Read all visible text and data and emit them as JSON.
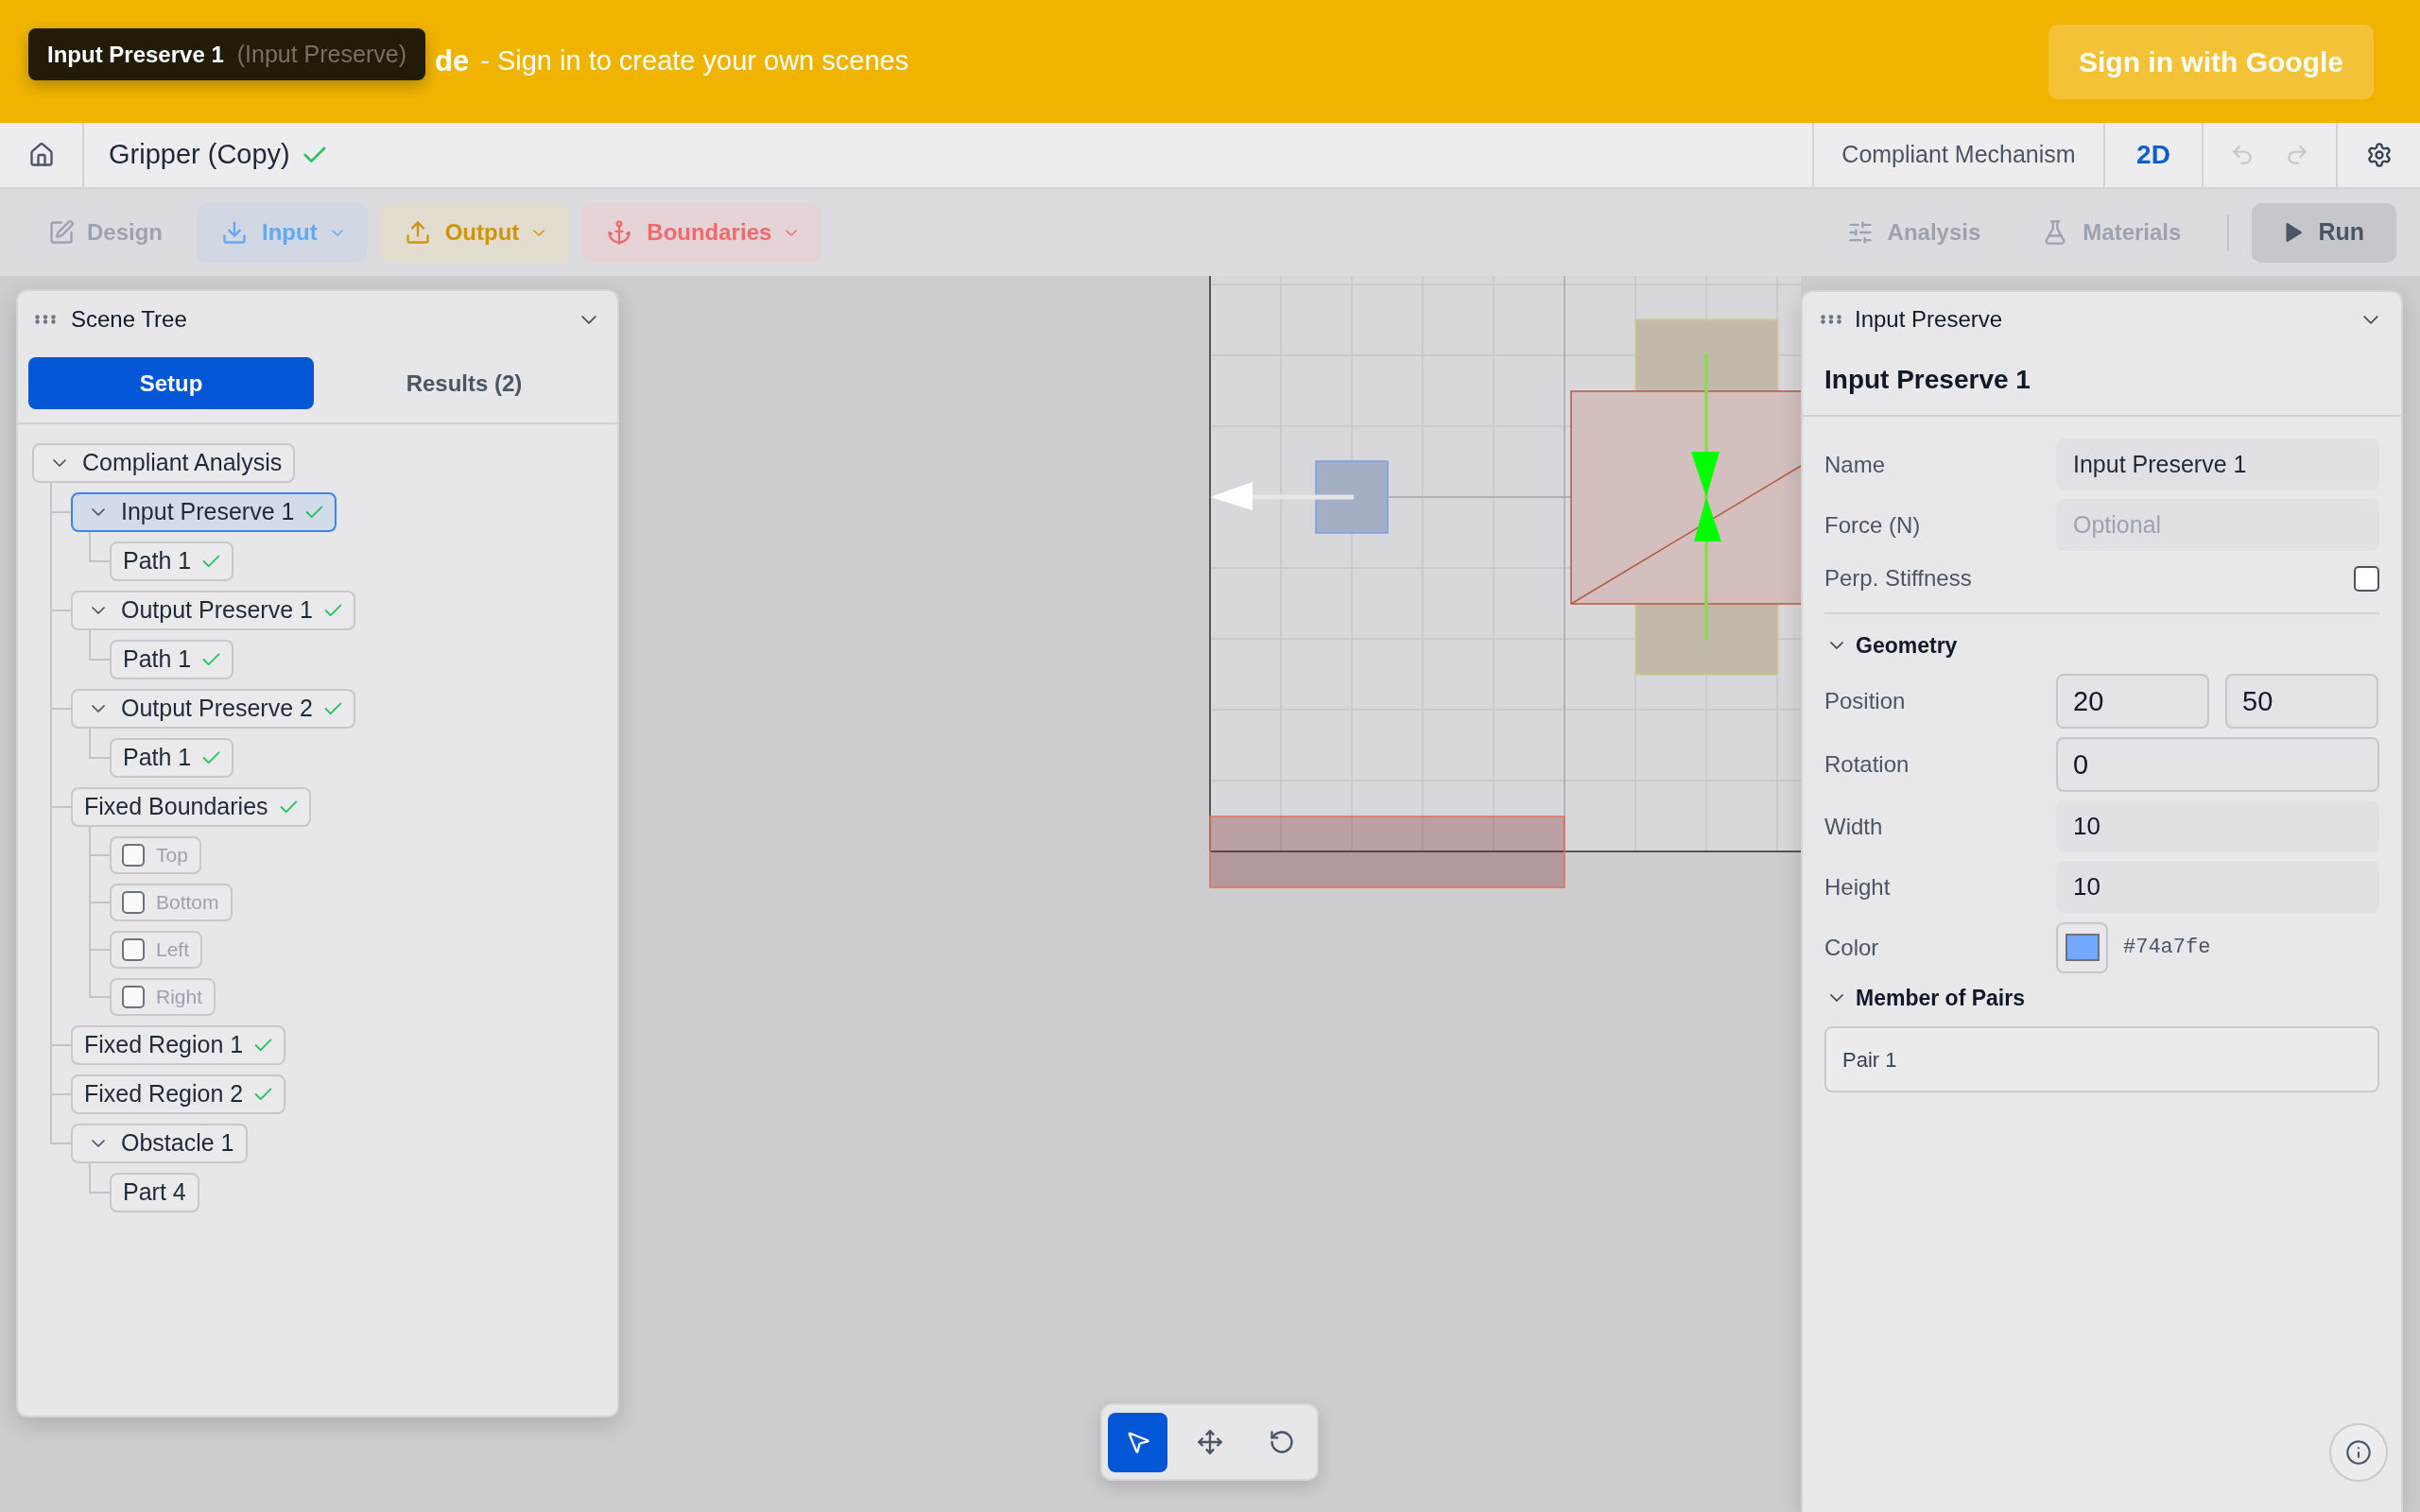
{
  "banner": {
    "title": "de",
    "message": "- Sign in to create your own scenes",
    "button": "Sign in with Google"
  },
  "tooltip": {
    "title": "Input Preserve 1",
    "subtitle": "(Input Preserve)"
  },
  "header": {
    "project": "Gripper (Copy)",
    "saved": true,
    "mode": "Compliant Mechanism",
    "dimension": "2D",
    "undo_disabled": true,
    "redo_disabled": true
  },
  "toolbar": {
    "tools": [
      {
        "kind": "design",
        "label": "Design",
        "disabled": true
      },
      {
        "kind": "input",
        "label": "Input",
        "disabled": true
      },
      {
        "kind": "output",
        "label": "Output",
        "disabled": true
      },
      {
        "kind": "boundaries",
        "label": "Boundaries",
        "disabled": true
      }
    ],
    "panels": [
      {
        "kind": "analysis",
        "label": "Analysis",
        "disabled": true
      },
      {
        "kind": "materials",
        "label": "Materials",
        "disabled": true
      }
    ],
    "run": {
      "label": "Run",
      "disabled": true
    }
  },
  "scene_tree": {
    "title": "Scene Tree",
    "tabs": [
      {
        "label": "Setup",
        "selected": true
      },
      {
        "label": "Results (2)",
        "selected": false
      }
    ],
    "items": [
      {
        "kind": "group",
        "label": "Compliant Analysis",
        "expanded": true,
        "valid": false,
        "selected": false,
        "children": [
          {
            "kind": "group",
            "label": "Input Preserve 1",
            "expanded": true,
            "valid": true,
            "selected": true,
            "children": [
              {
                "kind": "leaf",
                "label": "Path 1",
                "valid": true,
                "selected": false
              }
            ]
          },
          {
            "kind": "group",
            "label": "Output Preserve 1",
            "expanded": true,
            "valid": true,
            "selected": false,
            "children": [
              {
                "kind": "leaf",
                "label": "Path 1",
                "valid": true,
                "selected": false
              }
            ]
          },
          {
            "kind": "group",
            "label": "Output Preserve 2",
            "expanded": true,
            "valid": true,
            "selected": false,
            "children": [
              {
                "kind": "leaf",
                "label": "Path 1",
                "valid": true,
                "selected": false
              }
            ]
          },
          {
            "kind": "leaf",
            "label": "Fixed Boundaries",
            "valid": true,
            "selected": false,
            "children": [
              {
                "kind": "checkbox",
                "label": "Top",
                "checked": false,
                "selected": false
              },
              {
                "kind": "checkbox",
                "label": "Bottom",
                "checked": false,
                "selected": false
              },
              {
                "kind": "checkbox",
                "label": "Left",
                "checked": false,
                "selected": false
              },
              {
                "kind": "checkbox",
                "label": "Right",
                "checked": false,
                "selected": false
              }
            ]
          },
          {
            "kind": "leaf",
            "label": "Fixed Region 1",
            "valid": true,
            "selected": false
          },
          {
            "kind": "leaf",
            "label": "Fixed Region 2",
            "valid": true,
            "selected": false
          },
          {
            "kind": "group",
            "label": "Obstacle 1",
            "expanded": true,
            "valid": false,
            "selected": false,
            "children": [
              {
                "kind": "leaf",
                "label": "Part 4",
                "valid": false,
                "selected": false
              }
            ]
          }
        ]
      }
    ]
  },
  "inspector": {
    "panel_title": "Input Preserve",
    "title": "Input Preserve 1",
    "fields": [
      {
        "kind": "text",
        "label": "Name",
        "value": "Input Preserve 1"
      },
      {
        "kind": "text",
        "label": "Force (N)",
        "placeholder": "Optional"
      },
      {
        "kind": "checkbox",
        "label": "Perp. Stiffness",
        "checked": false
      }
    ],
    "sections": [
      {
        "title": "Geometry",
        "expanded": true,
        "fields": [
          {
            "kind": "pair",
            "label": "Position",
            "values": [
              "20",
              "50"
            ]
          },
          {
            "kind": "number",
            "label": "Rotation",
            "value": "0"
          },
          {
            "kind": "text",
            "label": "Width",
            "value": "10"
          },
          {
            "kind": "text",
            "label": "Height",
            "value": "10"
          },
          {
            "kind": "color",
            "label": "Color",
            "color": "#74a7fe",
            "value": "#74a7fe"
          }
        ]
      },
      {
        "title": "Member of Pairs",
        "expanded": true,
        "items": [
          "Pair 1"
        ]
      }
    ]
  },
  "canvas_tools": [
    {
      "kind": "select",
      "selected": true
    },
    {
      "kind": "move",
      "selected": false
    },
    {
      "kind": "rotate",
      "selected": false
    }
  ]
}
